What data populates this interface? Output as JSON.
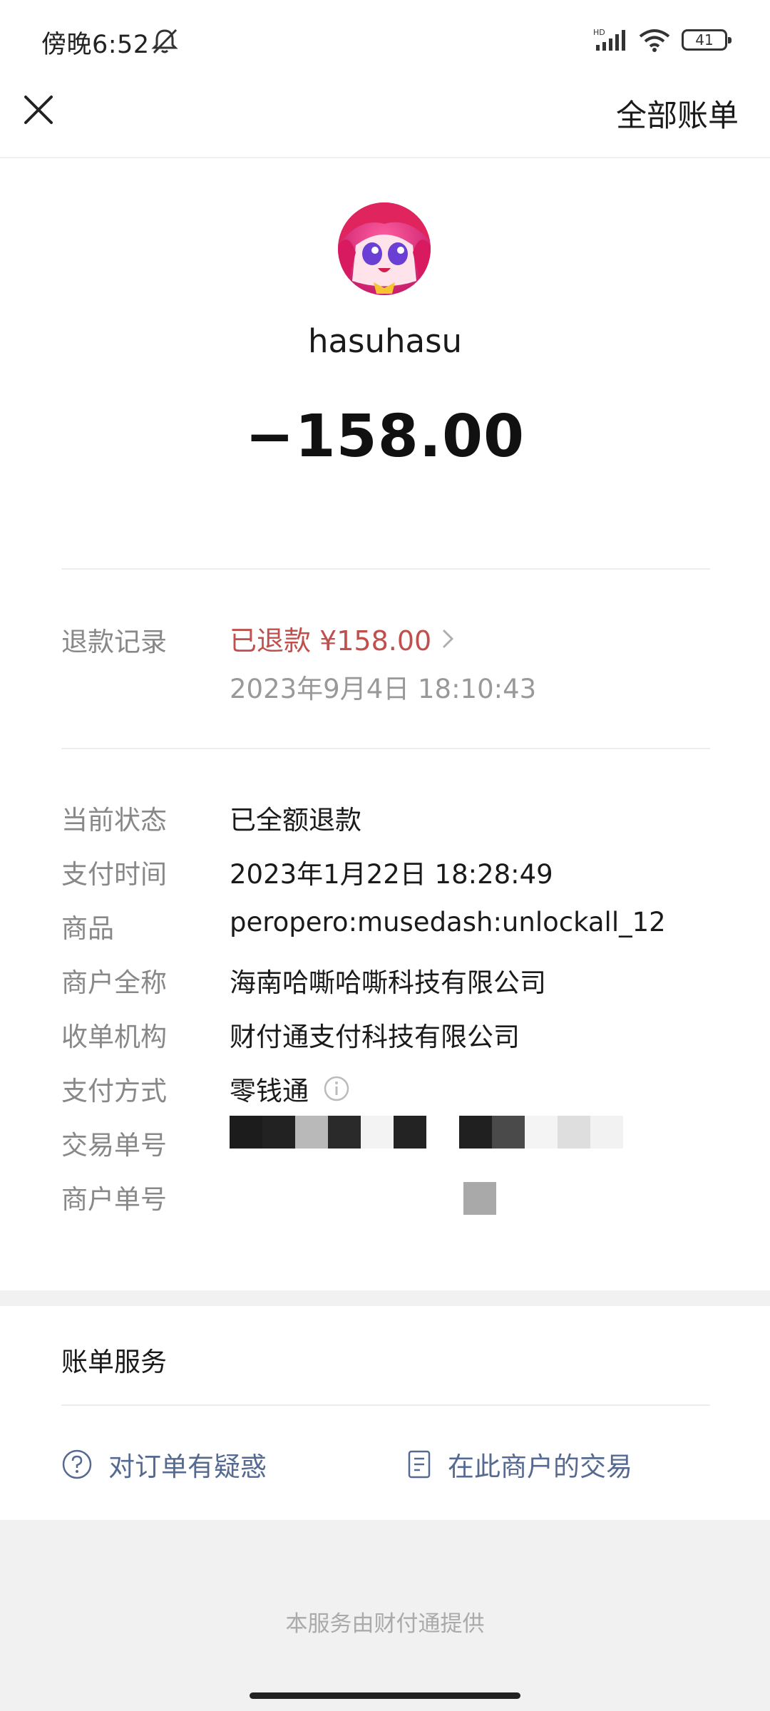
{
  "status_bar": {
    "time": "傍晚6:52",
    "network": "HD",
    "battery": "41"
  },
  "header": {
    "all_bills_label": "全部账单"
  },
  "merchant": {
    "name": "hasuhasu",
    "amount": "−158.00"
  },
  "refund": {
    "label": "退款记录",
    "status": "已退款 ¥158.00",
    "time": "2023年9月4日 18:10:43"
  },
  "details": {
    "status_label": "当前状态",
    "status_value": "已全额退款",
    "pay_time_label": "支付时间",
    "pay_time_value": "2023年1月22日 18:28:49",
    "goods_label": "商品",
    "goods_value": "peropero:musedash:unlockall_12",
    "merchant_fullname_label": "商户全称",
    "merchant_fullname_value": "海南哈嘶哈嘶科技有限公司",
    "acquirer_label": "收单机构",
    "acquirer_value": "财付通支付科技有限公司",
    "pay_method_label": "支付方式",
    "pay_method_value": "零钱通",
    "trade_no_label": "交易单号",
    "merchant_no_label": "商户单号"
  },
  "service": {
    "title": "账单服务",
    "question_label": "对订单有疑惑",
    "merchant_trades_label": "在此商户的交易"
  },
  "footer": {
    "provider_text": "本服务由财付通提供"
  },
  "icons": {
    "close": "close-icon",
    "bell_off": "bell-off-icon",
    "signal": "signal-icon",
    "wifi": "wifi-icon",
    "battery": "battery-icon",
    "chevron": "chevron-right-icon",
    "info": "info-icon",
    "question": "question-icon",
    "document": "document-icon"
  },
  "colors": {
    "refund_red": "#c0504d",
    "link_blue": "#566a91",
    "label_gray": "#888888"
  }
}
